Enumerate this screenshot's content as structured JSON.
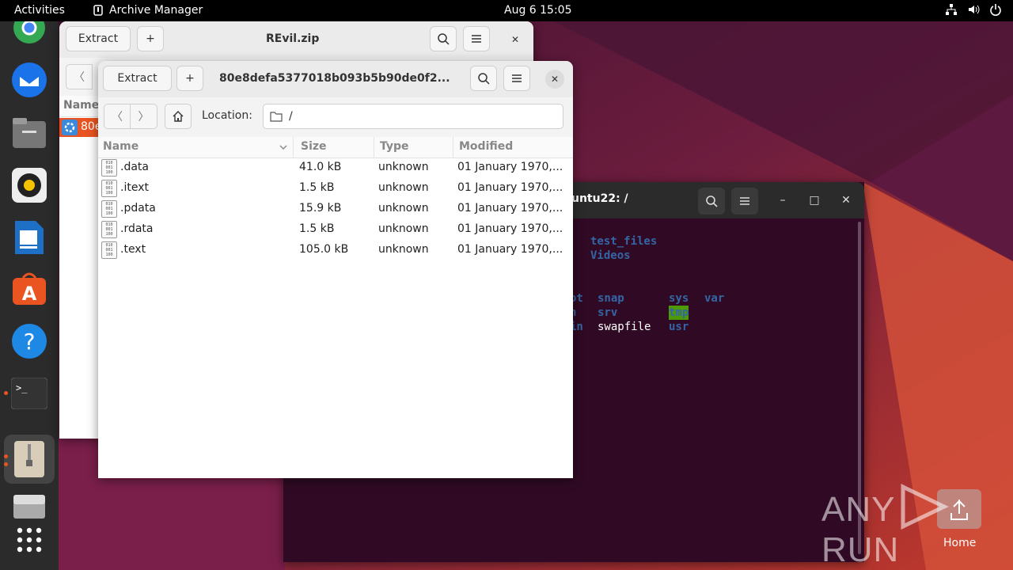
{
  "topbar": {
    "activities": "Activities",
    "app_name": "Archive Manager",
    "clock": "Aug 6  15:05"
  },
  "terminal": {
    "title": "untu22: /",
    "lines": [
      [
        "",
        "test_files"
      ],
      [
        "",
        "Videos"
      ],
      [
        "ot",
        "snap",
        "sys",
        "var"
      ],
      [
        "n",
        "srv",
        "tmp"
      ],
      [
        "in",
        "swapfile",
        "usr"
      ]
    ]
  },
  "back_window": {
    "title": "REvil.zip",
    "extract_label": "Extract",
    "col_name": "Name",
    "row_name": "80e"
  },
  "front_window": {
    "title": "80e8defa5377018b093b5b90de0f2...",
    "extract_label": "Extract",
    "location_label": "Location:",
    "location_value": "/",
    "columns": {
      "name": "Name",
      "size": "Size",
      "type": "Type",
      "modified": "Modified"
    },
    "files": [
      {
        "name": ".data",
        "size": "41.0 kB",
        "type": "unknown",
        "modified": "01 January 1970,..."
      },
      {
        "name": ".itext",
        "size": "1.5 kB",
        "type": "unknown",
        "modified": "01 January 1970,..."
      },
      {
        "name": ".pdata",
        "size": "15.9 kB",
        "type": "unknown",
        "modified": "01 January 1970,..."
      },
      {
        "name": ".rdata",
        "size": "1.5 kB",
        "type": "unknown",
        "modified": "01 January 1970,..."
      },
      {
        "name": ".text",
        "size": "105.0 kB",
        "type": "unknown",
        "modified": "01 January 1970,..."
      }
    ]
  },
  "desktop": {
    "home_label": "Home",
    "watermark": "ANY RUN"
  },
  "dock": [
    "chrome-icon",
    "thunderbird-icon",
    "files-icon",
    "rhythmbox-icon",
    "writer-icon",
    "app-center-icon",
    "help-icon",
    "terminal-icon",
    "archive-manager-icon",
    "drive-icon",
    "show-apps-icon"
  ],
  "colors": {
    "accent": "#e95420",
    "terminal_bg": "#300a24",
    "dock_bg": "#2b2b2b"
  }
}
